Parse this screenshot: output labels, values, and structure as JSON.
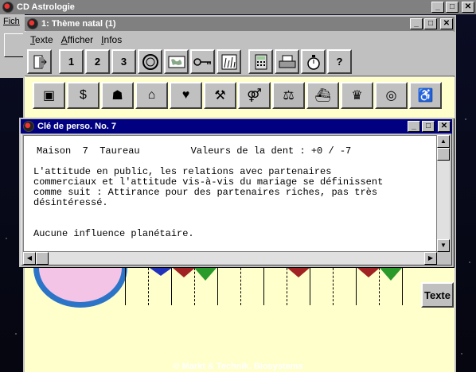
{
  "app": {
    "title": "CD Astrologie",
    "menu_partial": "Fich",
    "footer": "© Markt & Technik. Biosystems"
  },
  "child": {
    "title": "1: Thème natal (1)",
    "menu": [
      "Texte",
      "Afficher",
      "Infos"
    ],
    "toolbar_labels": [
      "1",
      "2",
      "3",
      "?"
    ]
  },
  "chart_window": {
    "texte_button": "Texte"
  },
  "dialog": {
    "title": "Clé de perso. No. 7",
    "header_left": "Maison  7  Taureau",
    "header_right": "Valeurs de la dent : +0 / -7",
    "paragraph": "L'attitude en public, les relations avec partenaires\ncommerciaux  et l'attitude vis-à-vis du mariage se définissent\ncomme suit : Attirance pour des partenaires riches, pas très\ndésintéressé.",
    "influence": "Aucune influence planétaire."
  },
  "icons": {
    "window_controls": [
      "minimize-icon",
      "maximize-icon",
      "close-icon"
    ],
    "toolbar": [
      "exit-door-icon",
      "page-1-icon",
      "page-2-icon",
      "page-3-icon",
      "wheel-icon",
      "world-map-icon",
      "key-icon",
      "bar-chart-icon",
      "calculator-icon",
      "printer-icon",
      "stopwatch-icon",
      "help-icon"
    ],
    "houses": [
      "person-card-icon",
      "money-bag-icon",
      "siblings-icon",
      "house-icon",
      "heart-icon",
      "tools-icon",
      "partners-icon",
      "scales-icon",
      "ship-icon",
      "crown-icon",
      "globe-friends-icon",
      "person-sitting-icon"
    ]
  },
  "colors": {
    "active_title": "#000080",
    "inactive_title": "#808080",
    "chart_background": "#ffffcc",
    "wheel_ring": "#2b74c8",
    "wheel_fill": "#f4c4e6",
    "marker_green": "#2a9a2a",
    "marker_red": "#a02222"
  }
}
